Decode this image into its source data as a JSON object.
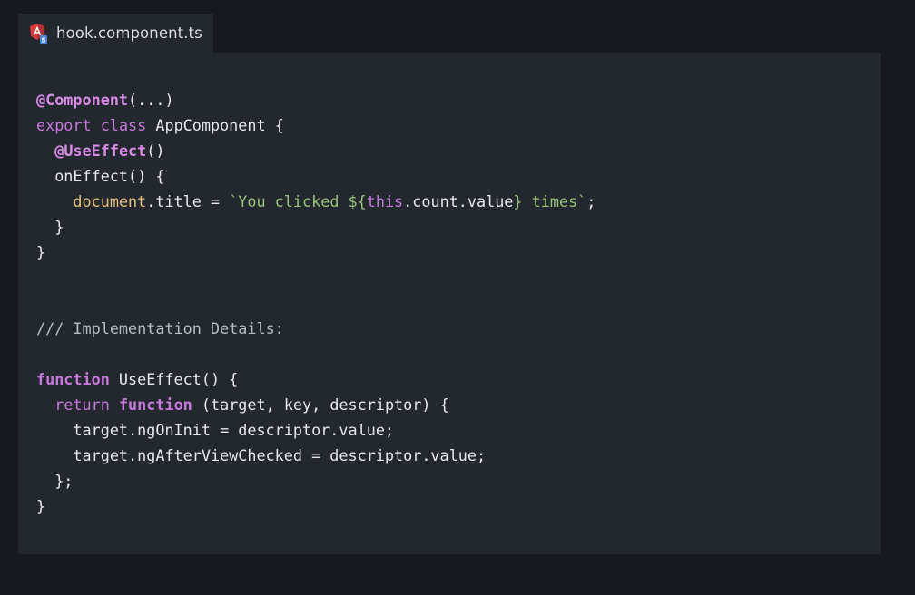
{
  "tab": {
    "title": "hook.component.ts",
    "icon": "angular-icon",
    "icon_colors": {
      "shield": "#dd3b3b",
      "letter": "#ffffff",
      "badge": "#4a88d9"
    }
  },
  "theme": {
    "page_background": "#16191d",
    "editor_background": "#23272e",
    "text": "#e6e8eb",
    "keyword": "#c678dd",
    "global": "#e5c07b",
    "string": "#98c379",
    "comment": "#b8bcc4"
  },
  "code": {
    "lines": [
      [
        {
          "t": "@Component",
          "c": "decorator"
        },
        {
          "t": "(...)",
          "c": "plain"
        }
      ],
      [
        {
          "t": "export ",
          "c": "keyword"
        },
        {
          "t": "class ",
          "c": "keyword"
        },
        {
          "t": "AppComponent {",
          "c": "plain"
        }
      ],
      [
        {
          "t": "  ",
          "c": "plain"
        },
        {
          "t": "@UseEffect",
          "c": "decorator"
        },
        {
          "t": "()",
          "c": "plain"
        }
      ],
      [
        {
          "t": "  onEffect() {",
          "c": "plain"
        }
      ],
      [
        {
          "t": "    ",
          "c": "plain"
        },
        {
          "t": "document",
          "c": "global"
        },
        {
          "t": ".title = ",
          "c": "plain"
        },
        {
          "t": "`You clicked ${",
          "c": "string"
        },
        {
          "t": "this",
          "c": "this"
        },
        {
          "t": ".count.value",
          "c": "plain"
        },
        {
          "t": "} times`",
          "c": "string"
        },
        {
          "t": ";",
          "c": "plain"
        }
      ],
      [
        {
          "t": "  }",
          "c": "plain"
        }
      ],
      [
        {
          "t": "}",
          "c": "plain"
        }
      ],
      [],
      [],
      [
        {
          "t": "/// Implementation Details:",
          "c": "comment"
        }
      ],
      [],
      [
        {
          "t": "function",
          "c": "keyword-bold"
        },
        {
          "t": " UseEffect() {",
          "c": "plain"
        }
      ],
      [
        {
          "t": "  ",
          "c": "plain"
        },
        {
          "t": "return ",
          "c": "keyword"
        },
        {
          "t": "function",
          "c": "keyword-bold"
        },
        {
          "t": " (target, key, descriptor) {",
          "c": "plain"
        }
      ],
      [
        {
          "t": "    target.ngOnInit = descriptor.value;",
          "c": "plain"
        }
      ],
      [
        {
          "t": "    target.ngAfterViewChecked = descriptor.value;",
          "c": "plain"
        }
      ],
      [
        {
          "t": "  };",
          "c": "plain"
        }
      ],
      [
        {
          "t": "}",
          "c": "plain"
        }
      ]
    ]
  }
}
